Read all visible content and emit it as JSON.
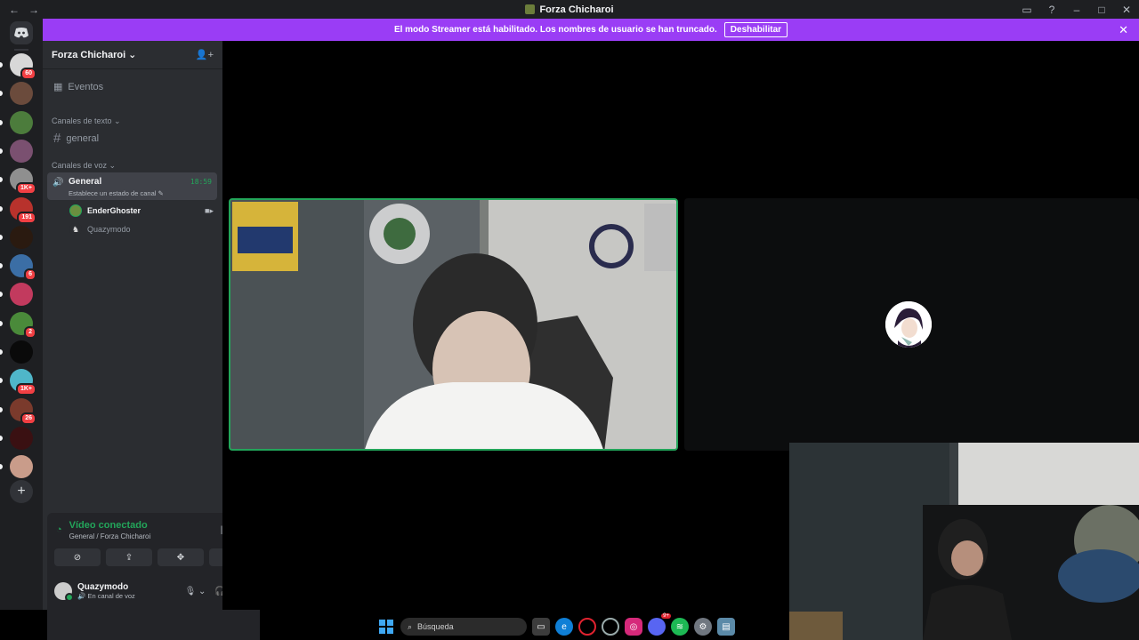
{
  "window": {
    "title": "Forza Chicharoi"
  },
  "banner": {
    "message": "El modo Streamer está habilitado. Los nombres de usuario se han truncado.",
    "button": "Deshabilitar"
  },
  "servers": [
    {
      "badge": "60"
    },
    {
      "badge": ""
    },
    {
      "badge": ""
    },
    {
      "badge": ""
    },
    {
      "badge": "1K+"
    },
    {
      "badge": "191"
    },
    {
      "badge": ""
    },
    {
      "badge": "6"
    },
    {
      "badge": ""
    },
    {
      "badge": "2"
    },
    {
      "badge": ""
    },
    {
      "badge": "1K+"
    },
    {
      "badge": "26"
    },
    {
      "badge": ""
    },
    {
      "badge": ""
    }
  ],
  "sidebar": {
    "server_name": "Forza Chicharoi",
    "events_label": "Eventos",
    "text_category": "Canales de texto",
    "text_channel": "general",
    "voice_category": "Canales de voz",
    "voice_channel": {
      "name": "General",
      "status": "Establece un estado de canal",
      "time": "18:59"
    },
    "voice_users": [
      {
        "name": "EnderGhoster"
      },
      {
        "name": "Quazymodo"
      }
    ]
  },
  "connection": {
    "label": "Vídeo conectado",
    "location": "General / Forza Chicharoi",
    "user_name": "Quazymodo",
    "user_status": "En canal de voz"
  },
  "taskbar": {
    "search_placeholder": "Búsqueda",
    "discord_badge": "9+"
  },
  "colors": {
    "banner": "#9a3df5",
    "connected_green": "#23a55a",
    "sidebar_bg": "#2b2d31",
    "rail_bg": "#1e1f22"
  }
}
